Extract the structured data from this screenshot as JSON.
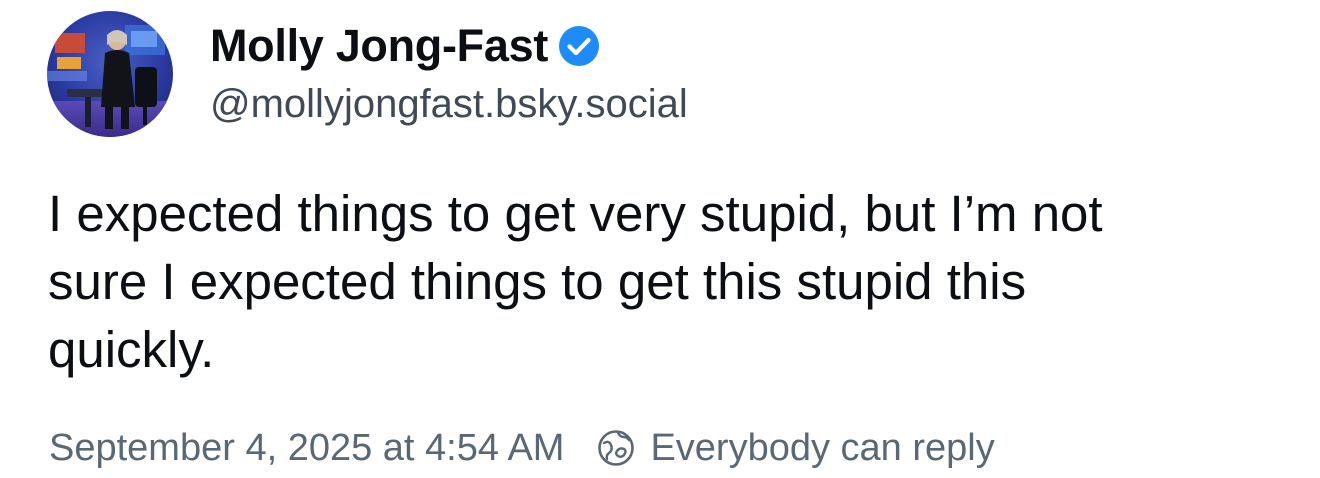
{
  "author": {
    "display_name": "Molly Jong-Fast",
    "handle": "@mollyjongfast.bsky.social",
    "verified_icon": "verified-check-icon",
    "avatar_icon": "avatar-photo"
  },
  "post": {
    "text_lines": [
      "I expected things to get very stupid, but I’m not",
      "sure I expected things to get this stupid this",
      "quickly."
    ]
  },
  "meta": {
    "timestamp": "September 4, 2025 at 4:54 AM",
    "reply_setting": "Everybody can reply",
    "reply_icon": "globe-icon"
  },
  "colors": {
    "verified_blue": "#1d8cf8",
    "name_text": "#0b0f14",
    "handle_text": "#3f4a56",
    "meta_text": "#5a6876"
  }
}
